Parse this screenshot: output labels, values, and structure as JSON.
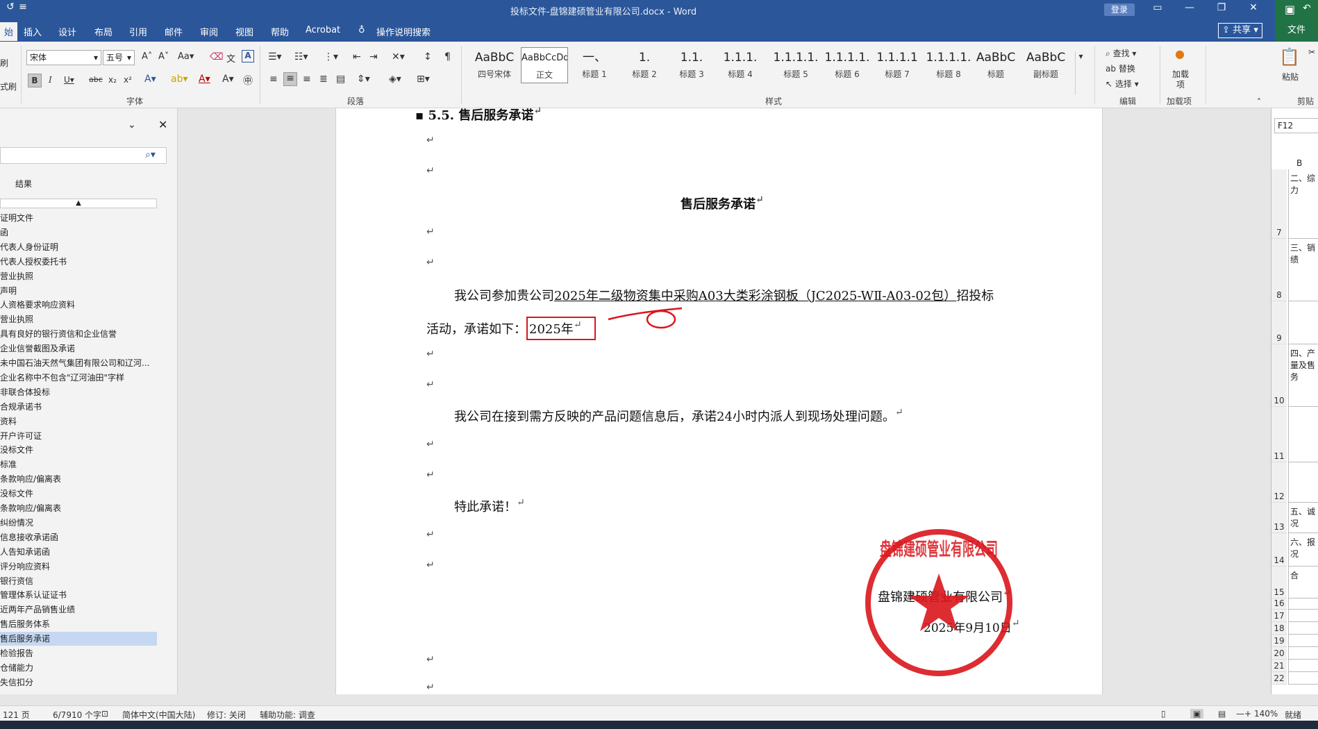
{
  "window": {
    "title": "投标文件-盘锦建硕管业有限公司.docx  -  Word",
    "login": "登录",
    "share": "共享",
    "excel_file": "文件"
  },
  "tabs": [
    "插入",
    "设计",
    "布局",
    "引用",
    "邮件",
    "审阅",
    "视图",
    "帮助",
    "Acrobat"
  ],
  "active_tab_partial": "始",
  "tell_me": "操作说明搜索",
  "ribbon": {
    "font_name": "宋体",
    "font_size": "五号",
    "group_font": "字体",
    "group_paragraph": "段落",
    "group_styles": "样式",
    "group_edit": "编辑",
    "group_addins": "加载项",
    "group_clipboard": "剪贴",
    "find": "查找",
    "replace": "替换",
    "select": "选择",
    "addins_btn": "加载项",
    "paste": "粘贴",
    "styles": [
      {
        "sample": "AaBbC",
        "name": "四号宋体"
      },
      {
        "sample": "AaBbCcDd",
        "name": "正文"
      },
      {
        "sample": "一、",
        "name": "标题 1"
      },
      {
        "sample": "1.",
        "name": "标题 2"
      },
      {
        "sample": "1.1.",
        "name": "标题 3"
      },
      {
        "sample": "1.1.1.",
        "name": "标题 4"
      },
      {
        "sample": "1.1.1.1.",
        "name": "标题 5"
      },
      {
        "sample": "1.1.1.1.",
        "name": "标题 6"
      },
      {
        "sample": "1.1.1.1",
        "name": "标题 7"
      },
      {
        "sample": "1.1.1.1.",
        "name": "标题 8"
      },
      {
        "sample": "AaBbC",
        "name": "标题"
      },
      {
        "sample": "AaBbC",
        "name": "副标题"
      }
    ]
  },
  "nav": {
    "results_label": "结果",
    "items": [
      "证明文件",
      "函",
      "代表人身份证明",
      "代表人授权委托书",
      "营业执照",
      "声明",
      "人资格要求响应资料",
      "营业执照",
      "具有良好的银行资信和企业信誉",
      "企业信誉截图及承诺",
      "未中国石油天然气集团有限公司和辽河...",
      "企业名称中不包含\"辽河油田\"字样",
      "非联合体投标",
      "合规承诺书",
      "资料",
      "开户许可证",
      "没标文件",
      "标准",
      "条款响应/偏离表",
      "没标文件",
      "条款响应/偏离表",
      "纠纷情况",
      "信息接收承诺函",
      "人告知承诺函",
      "评分响应资料",
      "银行资信",
      "管理体系认证证书",
      "近两年产品销售业绩",
      "售后服务体系",
      "售后服务承诺",
      "检验报告",
      "仓储能力",
      "失信扣分"
    ],
    "selected_index": 29
  },
  "document": {
    "heading": "5.5. 售后服务承诺",
    "title": "售后服务承诺",
    "p1_start": "我公司参加贵公司",
    "p1_underlined": "2025年二级物资集中采购A03大类彩涂钢板（JC2025-WⅡ-A03-02包）",
    "p1_end": "招投标",
    "p2_start": "活动，承诺如下：",
    "p2_box": "2025年",
    "p3": "我公司在接到需方反映的产品问题信息后，承诺24小时内派人到现场处理问题。",
    "p4": "特此承诺！",
    "signature_company": "盘锦建硕管业有限公司",
    "signature_date": "2025年9月10日",
    "stamp_text": "盘锦建硕管业有限公司"
  },
  "excel": {
    "name_box": "F12",
    "col": "B",
    "rows": [
      {
        "num": "7",
        "text": "二、综力"
      },
      {
        "num": "8",
        "text": "三、销绩"
      },
      {
        "num": "9",
        "text": ""
      },
      {
        "num": "10",
        "text": "四、产量及售务"
      },
      {
        "num": "11",
        "text": ""
      },
      {
        "num": "12",
        "text": ""
      },
      {
        "num": "13",
        "text": "五、诚况"
      },
      {
        "num": "14",
        "text": "六、报况"
      },
      {
        "num": "15",
        "text": "合"
      },
      {
        "num": "16",
        "text": ""
      },
      {
        "num": "17",
        "text": ""
      },
      {
        "num": "18",
        "text": ""
      },
      {
        "num": "19",
        "text": ""
      },
      {
        "num": "20",
        "text": ""
      },
      {
        "num": "21",
        "text": ""
      },
      {
        "num": "22",
        "text": ""
      }
    ]
  },
  "status": {
    "pages": "121 页",
    "words": "6/7910 个字",
    "language": "简体中文(中国大陆)",
    "track": "修订: 关闭",
    "accessibility": "辅助功能: 调查",
    "zoom": "140%",
    "excel_ready": "就绪"
  },
  "colors": {
    "word_blue": "#2b579a",
    "excel_green": "#217346",
    "stamp_red": "#d9161c"
  }
}
